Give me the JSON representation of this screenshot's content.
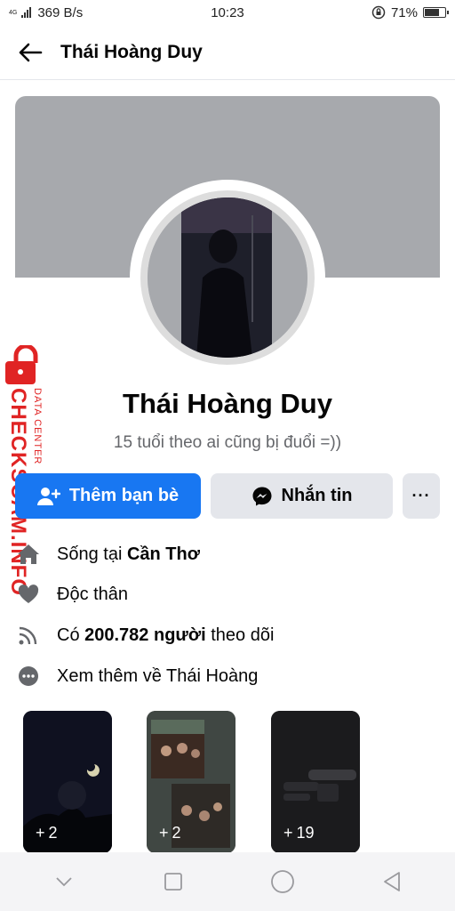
{
  "status_bar": {
    "network_type": "4G",
    "speed": "369 B/s",
    "time": "10:23",
    "battery": "71%",
    "battery_level": 0.71
  },
  "header": {
    "title": "Thái Hoàng Duy",
    "back_icon": "arrow-left-icon"
  },
  "profile": {
    "name": "Thái Hoàng Duy",
    "bio": "15 tuổi theo ai cũng bị đuổi =))",
    "cover_color": "#a7a9ad"
  },
  "actions": {
    "add_friend_label": "Thêm bạn bè",
    "message_label": "Nhắn tin",
    "more_label": "···",
    "accent_color": "#1877f2"
  },
  "info": {
    "lives_prefix": "Sống tại ",
    "lives_city": "Cần Thơ",
    "relationship": "Độc thân",
    "followers_prefix": "Có ",
    "followers_count": "200.782 người",
    "followers_suffix": " theo dõi",
    "see_more": "Xem thêm về Thái Hoàng"
  },
  "photos": [
    {
      "count": "2"
    },
    {
      "count": "2"
    },
    {
      "count": "19"
    }
  ],
  "watermark": {
    "brand": "CHECKSCAM.INFO",
    "sub": "DATA CENTER"
  }
}
